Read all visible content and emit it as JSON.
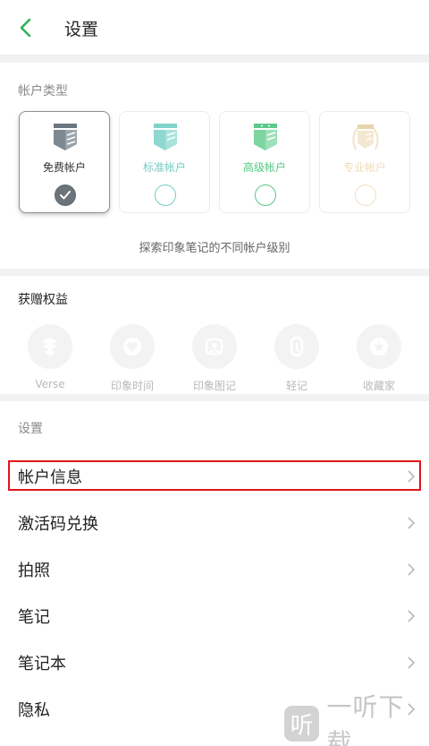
{
  "header": {
    "title": "设置"
  },
  "account_types": {
    "label": "帐户类型",
    "cards": [
      {
        "label": "免费帐户",
        "color": "#5f6b74",
        "selected": true
      },
      {
        "label": "标准帐户",
        "color": "#74ccc4",
        "selected": false
      },
      {
        "label": "高级帐户",
        "color": "#57c786",
        "selected": false
      },
      {
        "label": "专业帐户",
        "color": "#f1e0c2",
        "selected": false
      }
    ],
    "explore_link": "探索印象笔记的不同帐户级别"
  },
  "benefits": {
    "label": "获赠权益",
    "items": [
      {
        "label": "Verse",
        "icon": "verse-icon"
      },
      {
        "label": "印象时间",
        "icon": "heart-clock-icon"
      },
      {
        "label": "印象图记",
        "icon": "image-note-icon"
      },
      {
        "label": "轻记",
        "icon": "light-note-icon"
      },
      {
        "label": "收藏家",
        "icon": "star-badge-icon"
      }
    ]
  },
  "settings": {
    "label": "设置",
    "rows": [
      {
        "label": "帐户信息"
      },
      {
        "label": "激活码兑换"
      },
      {
        "label": "拍照"
      },
      {
        "label": "笔记"
      },
      {
        "label": "笔记本"
      },
      {
        "label": "隐私"
      }
    ]
  },
  "watermark": {
    "logo_text": "听",
    "text": "一听下载"
  },
  "colors": {
    "accent": "#2bb35a",
    "highlight": "#e0161b"
  }
}
